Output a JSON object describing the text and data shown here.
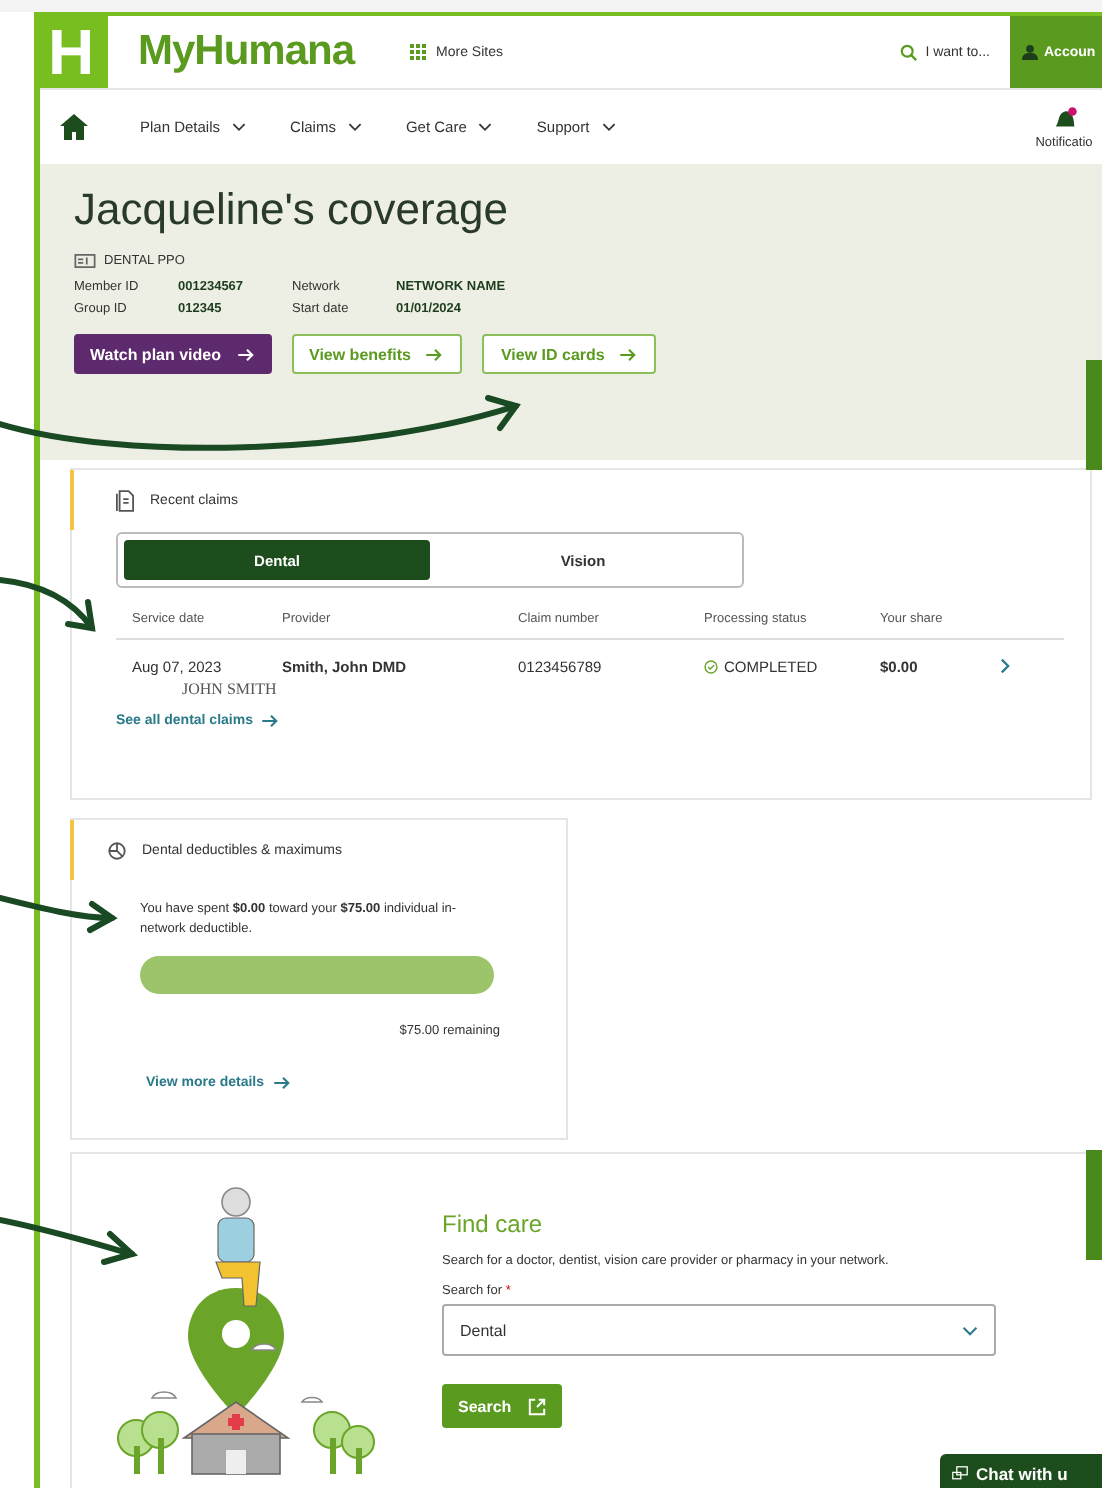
{
  "header": {
    "logo_letter": "H",
    "brand": "MyHumana",
    "more_sites": "More Sites",
    "search": "I want to...",
    "account": "Accoun"
  },
  "nav": {
    "items": [
      {
        "label": "Plan Details"
      },
      {
        "label": "Claims"
      },
      {
        "label": "Get Care"
      },
      {
        "label": "Support"
      }
    ],
    "notifications": "Notificatio"
  },
  "coverage": {
    "title": "Jacqueline's coverage",
    "plan": "DENTAL PPO",
    "details": [
      {
        "label": "Member ID",
        "value": "001234567"
      },
      {
        "label": "Network",
        "value": "NETWORK NAME"
      },
      {
        "label": "Group ID",
        "value": "012345"
      },
      {
        "label": "Start date",
        "value": "01/01/2024"
      }
    ],
    "buttons": [
      {
        "label": "Watch plan video",
        "kind": "primary"
      },
      {
        "label": "View benefits",
        "kind": "outline"
      },
      {
        "label": "View ID cards",
        "kind": "outline"
      }
    ]
  },
  "recent_claims": {
    "title": "Recent claims",
    "tabs": [
      {
        "label": "Dental",
        "selected": true
      },
      {
        "label": "Vision",
        "selected": false
      }
    ],
    "columns": [
      "Service date",
      "Provider",
      "Claim number",
      "Processing status",
      "Your share"
    ],
    "rows": [
      {
        "service_date": "Aug 07, 2023",
        "member": "JOHN SMITH",
        "provider": "Smith, John DMD",
        "claim_number": "0123456789",
        "status": "COMPLETED",
        "your_share": "$0.00"
      }
    ],
    "link": "See all dental claims"
  },
  "deductibles": {
    "title": "Dental deductibles & maximums",
    "summary": "You have spent **$0.00** toward your **$75.00** individual in-network deductible.",
    "level": 0,
    "remaining": "$75.00 remaining",
    "link": "View more details"
  },
  "find_care": {
    "title": "Find care",
    "description": "Search for a doctor, dentist, vision care provider or pharmacy in your network.",
    "field_label": "Search for",
    "required_mark": "*",
    "value": "Dental",
    "button": "Search"
  },
  "chat": "Chat with u"
}
